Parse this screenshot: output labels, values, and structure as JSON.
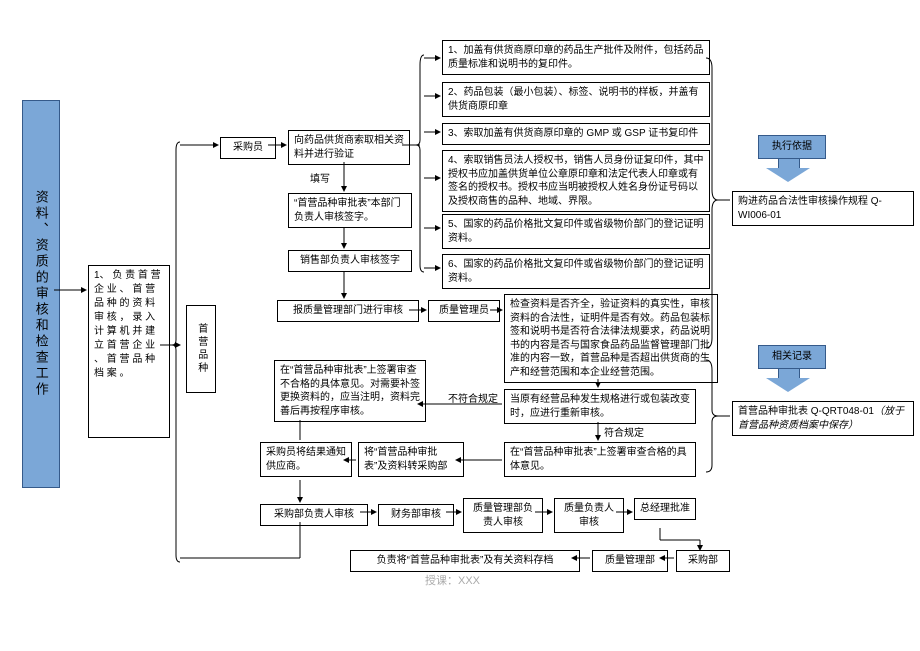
{
  "title_main": "资料、资质的审核和检查工作",
  "step1": "1、 负 责 首 营 企 业 、 首 营 品 种 的 资 料 审 核 ， 录 入 计 算 机 并 建 立 首 营 企 业 、 首 营 品 种 档 案 。",
  "category": "首营品种",
  "role_purchaser": "采购员",
  "node_request": "向药品供货商索取相关资料并进行验证",
  "lbl_fill": "填写",
  "node_form": "“首营品种审批表”本部门负责人审核签字。",
  "node_sales_sign": "销售部负责人审核签字",
  "node_report_qm": "报质量管理部门进行审核",
  "role_qm": "质量管理员",
  "doc1": "1、加盖有供货商原印章的药品生产批件及附件，包括药品质量标准和说明书的复印件。",
  "doc2": "2、药品包装（最小包装）、标签、说明书的样板，并盖有供货商原印章",
  "doc3": "3、索取加盖有供货商原印章的 GMP 或 GSP 证书复印件",
  "doc4": "4、索取销售员法人授权书，销售人员身份证复印件，其中授权书应加盖供货单位公章原印章和法定代表人印章或有签名的授权书。授权书应当明被授权人姓名身份证号码以及授权商售的品种、地域、界限。",
  "doc5": "5、国家的药品价格批文复印件或省级物价部门的登记证明资料。",
  "doc6": "6、国家的药品价格批文复印件或省级物价部门的登记证明资料。",
  "node_check": "检查资料是否齐全，验证资料的真实性，审核资料的合法性，证明件是否有效。药品包装标签和说明书是否符合法律法规要求，药品说明书的内容是否与国家食品药品监督管理部门批准的内容一致，首营品种是否超出供货商的生产和经营范围和本企业经营范围。",
  "node_change": "当原有经营品种发生规格进行或包装改变时，应进行重新审核。",
  "lbl_ok": "符合规定",
  "lbl_ng": "不符合规定",
  "node_sign_ok": "在“首营品种审批表”上签署审查合格的具体意见。",
  "node_sign_ng": "在“首营品种审批表”上签署审查不合格的具体意见。对需要补签更换资料的，应当注明，资料完善后再按程序审核。",
  "node_transfer": "将“首营品种审批表”及资料转采购部",
  "node_notify": "采购员将结果通知供应商。",
  "node_purchase_head": "采购部负责人审核",
  "node_finance": "财务部审核",
  "node_qm_head": "质量管理部负责人审核",
  "node_quality_head": "质量负责人审核",
  "node_gm": "总经理批准",
  "node_archive": "负责将“首营品种审批表”及有关资料存档",
  "role_qm_dept": "质量管理部",
  "role_purchase_dept": "采购部",
  "side_basis_title": "执行依据",
  "side_basis_text": "购进药品合法性审核操作规程 Q-WI006-01",
  "side_record_title": "相关记录",
  "side_record_text1": "首营品种审批表 Q-QRT048-01",
  "side_record_text2": "（放于首营品种资质档案中保存）",
  "watermark": "授课：XXX",
  "chart_data": {
    "type": "flowchart"
  }
}
